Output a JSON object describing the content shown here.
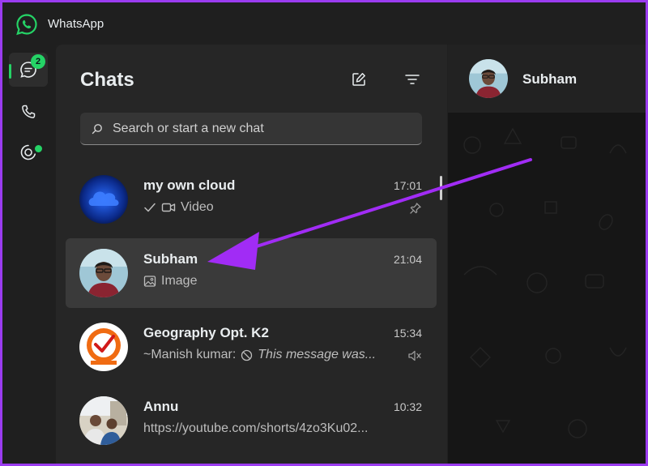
{
  "window": {
    "title": "WhatsApp"
  },
  "rail": {
    "chats_badge": "2",
    "items": [
      {
        "icon": "chat-icon",
        "active": true
      },
      {
        "icon": "phone-icon",
        "active": false
      },
      {
        "icon": "status-icon",
        "active": false
      }
    ]
  },
  "chatlist": {
    "title": "Chats",
    "search_placeholder": "Search or start a new chat",
    "chats": [
      {
        "name": "my own cloud",
        "time": "17:01",
        "preview": "Video",
        "preview_icon": "video-icon",
        "trail_icon": "pin-icon"
      },
      {
        "name": "Subham",
        "time": "21:04",
        "preview": "Image",
        "preview_icon": "image-icon",
        "selected": true
      },
      {
        "name": "Geography Opt. K2",
        "time": "15:34",
        "sender": "~Manish kumar:",
        "preview": "This message was...",
        "preview_icon": "blocked-icon",
        "trail_icon": "mute-icon"
      },
      {
        "name": "Annu",
        "time": "10:32",
        "preview": "https://youtube.com/shorts/4zo3Ku02..."
      }
    ]
  },
  "conversation": {
    "name": "Subham"
  },
  "colors": {
    "accent": "#25d366",
    "highlight_arrow": "#a12cf5",
    "frame": "#9b3cf0"
  }
}
